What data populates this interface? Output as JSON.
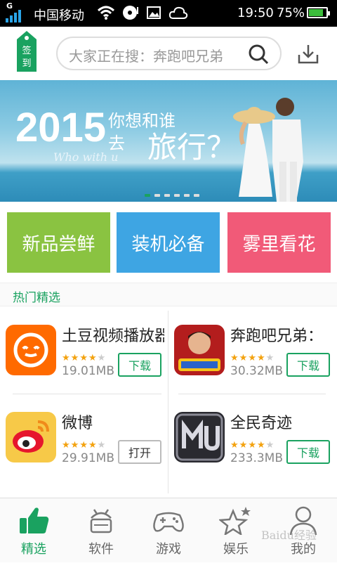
{
  "status_bar": {
    "network": "G",
    "carrier": "中国移动",
    "time": "19:50",
    "battery": "75%",
    "battery_level": 0.75
  },
  "header": {
    "signin_label": "签到",
    "search_placeholder": "大家正在搜：奔跑吧兄弟"
  },
  "banner": {
    "year": "2015",
    "line1": "你想和谁",
    "line2": "去",
    "line3": "旅行？",
    "script": "Who with u",
    "active_slide": 1,
    "slide_count": 6
  },
  "categories": [
    {
      "label": "新品尝鲜",
      "color": "#8ac341"
    },
    {
      "label": "装机必备",
      "color": "#3ea5e3"
    },
    {
      "label": "雾里看花",
      "color": "#f15a78"
    }
  ],
  "section_title": "热门精选",
  "apps": [
    {
      "name": "土豆视频播放器",
      "rating": 4,
      "size": "19.01MB",
      "button": "下载",
      "icon": "tudou-icon"
    },
    {
      "name": "奔跑吧兄弟：",
      "rating": 3.5,
      "size": "30.32MB",
      "button": "下载",
      "icon": "running-man-icon"
    },
    {
      "name": "微博",
      "rating": 4,
      "size": "29.91MB",
      "button": "打开",
      "icon": "weibo-icon"
    },
    {
      "name": "全民奇迹",
      "rating": 4,
      "size": "233.3MB",
      "button": "下载",
      "icon": "mu-icon"
    }
  ],
  "tabs": [
    {
      "label": "精选",
      "icon": "thumbs-up-icon",
      "active": true
    },
    {
      "label": "软件",
      "icon": "android-icon",
      "active": false
    },
    {
      "label": "游戏",
      "icon": "gamepad-icon",
      "active": false
    },
    {
      "label": "娱乐",
      "icon": "star-icon",
      "active": false
    },
    {
      "label": "我的",
      "icon": "person-icon",
      "active": false
    }
  ],
  "watermark": "Baidu经验",
  "colors": {
    "accent": "#1aa260",
    "star": "#f3a20f"
  }
}
